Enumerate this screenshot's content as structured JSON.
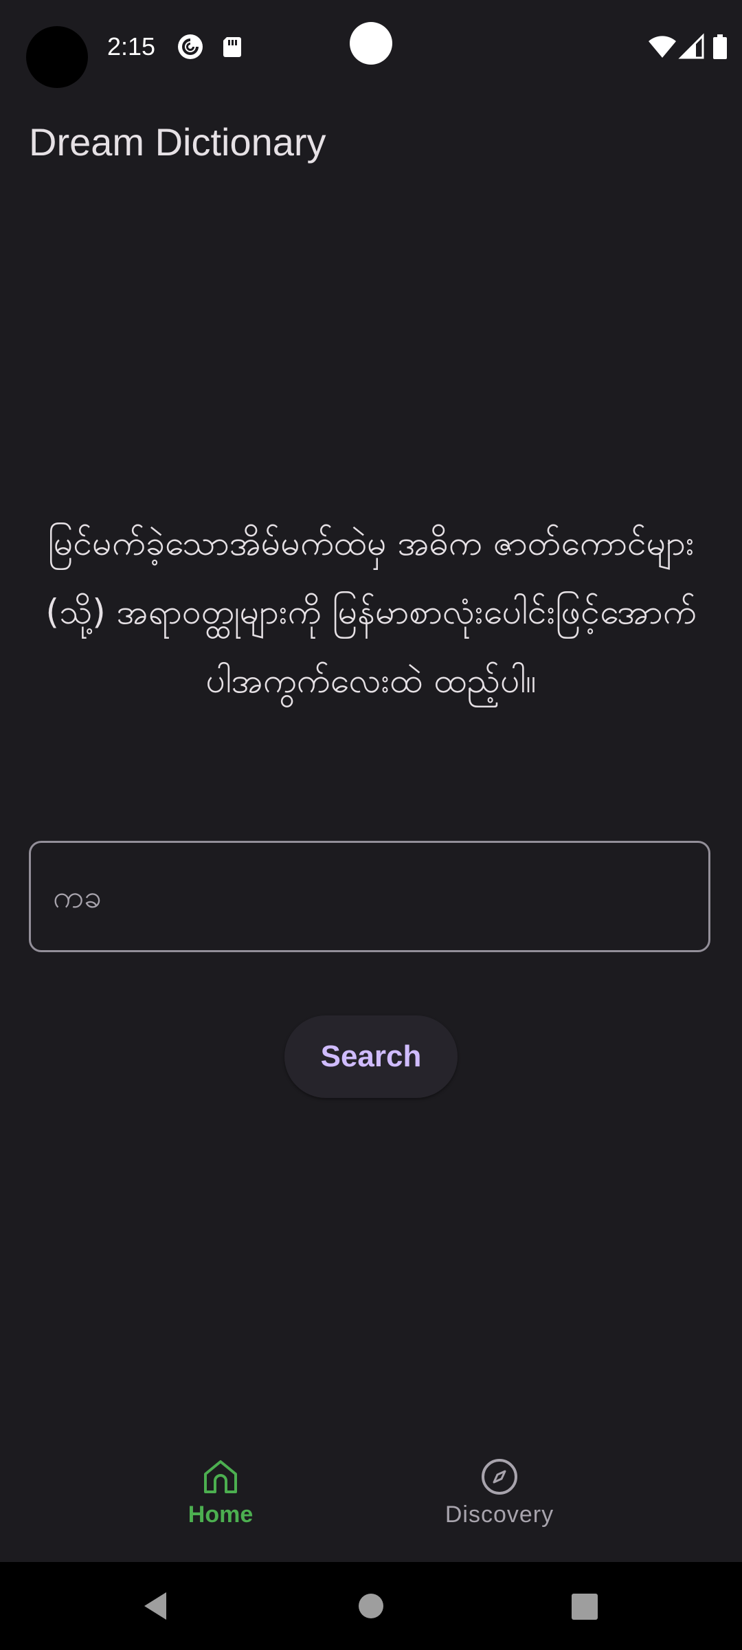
{
  "status_bar": {
    "time": "2:15",
    "icons": [
      "pocket-casts-icon",
      "sd-card-icon",
      "wifi-icon",
      "cell-signal-icon",
      "battery-icon"
    ]
  },
  "app_bar": {
    "title": "Dream Dictionary"
  },
  "main": {
    "intro_text": "မြင်မက်ခဲ့သောအိမ်မက်ထဲမှ အဓိက ဇာတ်ကောင်များ (သို့) အရာဝတ္ထုများကို မြန်မာစာလုံးပေါင်းဖြင့်အောက်ပါအကွက်လေးထဲ ထည့်ပါ။",
    "search_input": {
      "placeholder": "ကခ",
      "value": ""
    },
    "search_button_label": "Search"
  },
  "bottom_nav": {
    "items": [
      {
        "label": "Home",
        "icon": "home-icon",
        "active": true
      },
      {
        "label": "Discovery",
        "icon": "compass-icon",
        "active": false
      }
    ]
  },
  "colors": {
    "background": "#1c1b1f",
    "accent_active": "#4caf50",
    "button_text": "#d0bcff"
  }
}
